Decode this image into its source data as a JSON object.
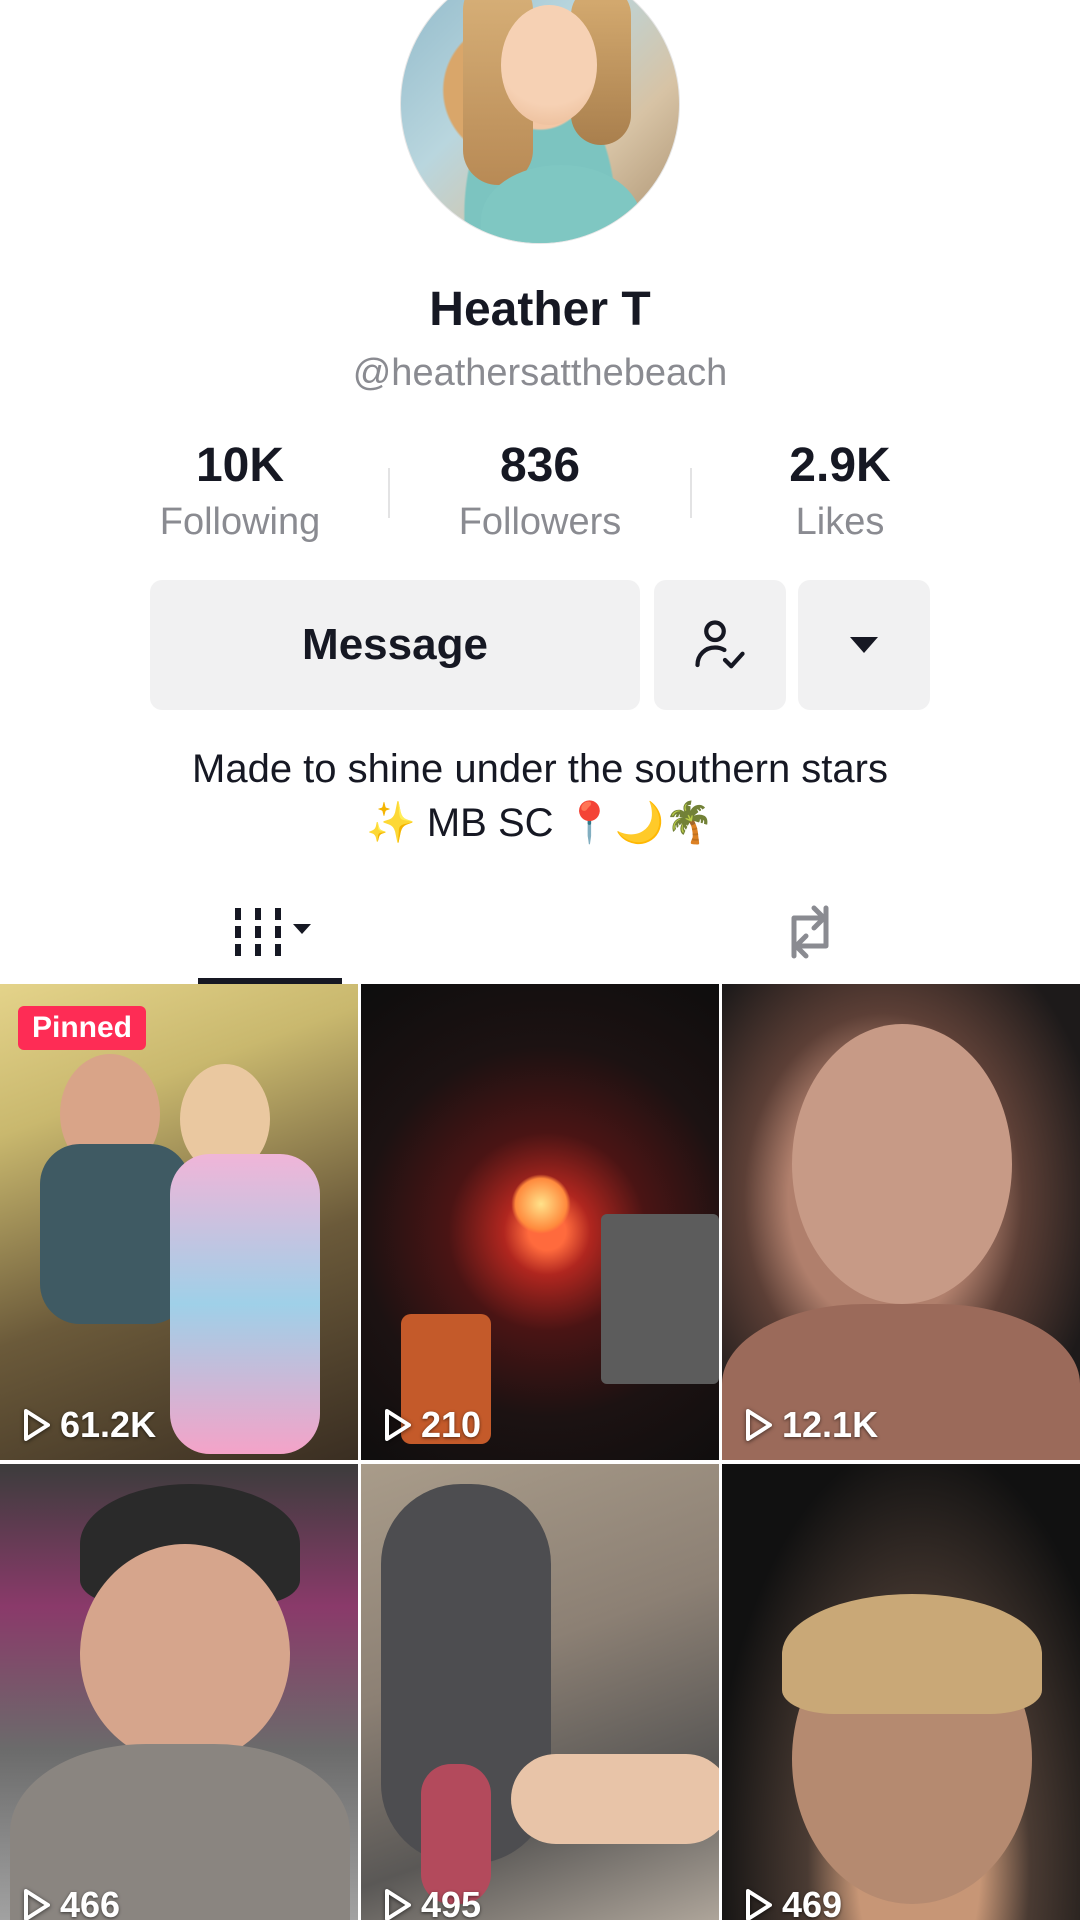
{
  "profile": {
    "name": "Heather T",
    "handle": "@heathersatthebeach",
    "bio_line1": "Made to shine under the southern stars",
    "bio_line2": "✨ MB SC 📍🌙🌴"
  },
  "stats": [
    {
      "value": "10K",
      "label": "Following"
    },
    {
      "value": "836",
      "label": "Followers"
    },
    {
      "value": "2.9K",
      "label": "Likes"
    }
  ],
  "actions": {
    "message_label": "Message",
    "follow_icon": "person-check-icon",
    "more_icon": "caret-down-icon"
  },
  "tabs": {
    "videos_icon": "grid-icon",
    "repost_icon": "repost-icon"
  },
  "videos": [
    {
      "views": "61.2K",
      "pinned": "Pinned"
    },
    {
      "views": "210"
    },
    {
      "views": "12.1K"
    },
    {
      "views": "466"
    },
    {
      "views": "495"
    },
    {
      "views": "469"
    }
  ],
  "colors": {
    "accent": "#fe2c55",
    "text": "#161823",
    "muted": "#8a8b91",
    "button_bg": "#f1f1f2"
  }
}
